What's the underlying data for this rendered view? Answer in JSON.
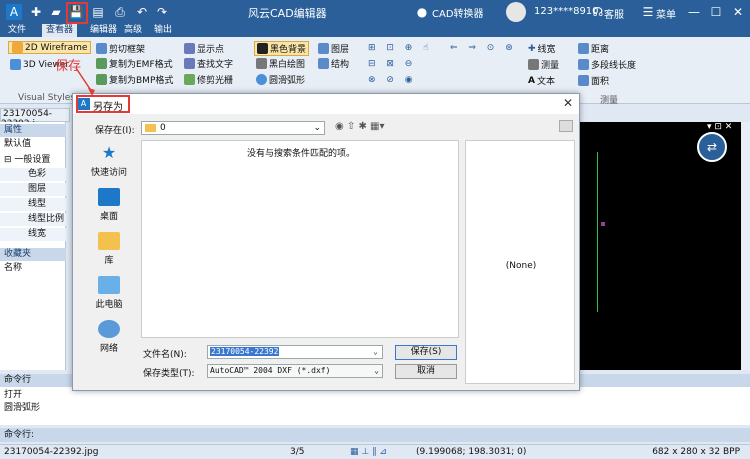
{
  "titlebar": {
    "app_title": "风云CAD编辑器",
    "cad_converter": "CAD转换器",
    "user": "123****8910",
    "service": "客服",
    "menu": "菜单"
  },
  "ribbon_tabs": [
    "文件",
    "查看器",
    "编辑器",
    "高级",
    "输出"
  ],
  "ribbon": {
    "visual_styles": {
      "label": "Visual Styles",
      "items": [
        "2D Wireframe",
        "3D Viewer"
      ]
    },
    "copy_group": [
      "剪切框架",
      "复制为EMF格式",
      "复制为BMP格式"
    ],
    "show_group": [
      "显示点",
      "查找文字",
      "修剪光栅"
    ],
    "bg_group": [
      "黑色背景",
      "黑白绘图",
      "圆滑弧形"
    ],
    "layer_group": [
      "图层",
      "结构"
    ],
    "measure_group": {
      "label": "测量",
      "items": [
        "线宽",
        "测量",
        "文本",
        "距离",
        "多段线长度",
        "面积"
      ]
    }
  },
  "annotation": {
    "save_label": "保存"
  },
  "doc_tab": "23170054-22392.j",
  "left_panel": {
    "header": "属性",
    "default": "默认值",
    "section": "一般设置",
    "props": [
      "色彩",
      "图层",
      "线型",
      "线型比例",
      "线宽"
    ],
    "fav_header": "收藏夹",
    "name": "名称"
  },
  "dialog": {
    "title": "另存为",
    "save_in_label": "保存在(I):",
    "save_in_value": "0",
    "empty_message": "没有与搜索条件匹配的项。",
    "places": [
      "快速访问",
      "桌面",
      "库",
      "此电脑",
      "网络"
    ],
    "preview": "(None)",
    "filename_label": "文件名(N):",
    "filename_value": "23170054-22392",
    "filetype_label": "保存类型(T):",
    "filetype_value": "AutoCAD™ 2004 DXF (*.dxf)",
    "save_button": "保存(S)",
    "cancel_button": "取消"
  },
  "command": {
    "header": "命令行",
    "log": [
      "打开",
      "圆滑弧形"
    ],
    "input_label": "命令行:"
  },
  "status": {
    "file": "23170054-22392.jpg",
    "page": "3/5",
    "coords": "(9.199068; 198.3031; 0)",
    "image_info": "682 x 280 x 32 BPP"
  },
  "colors": {
    "title_bar": "#2a5f99",
    "highlight_red": "#e53935",
    "selection": "#3a78d0"
  }
}
